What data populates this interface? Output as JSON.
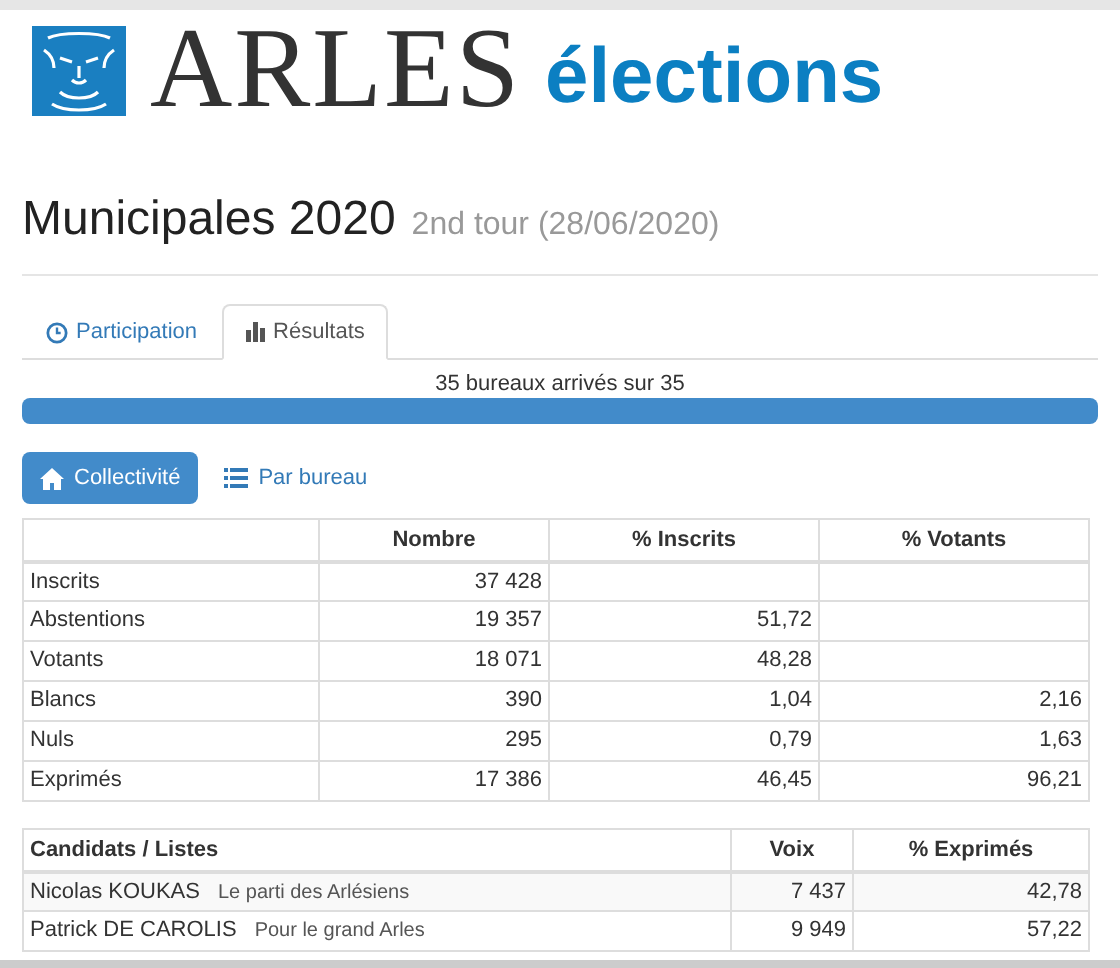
{
  "header": {
    "logo_word": "ARLES",
    "subtitle": "élections"
  },
  "title": {
    "main": "Municipales 2020",
    "sub": "2nd tour (28/06/2020)"
  },
  "tabs": [
    {
      "label": "Participation",
      "kind": "clock",
      "selected": false
    },
    {
      "label": "Résultats",
      "kind": "chart",
      "selected": true
    }
  ],
  "progress": {
    "label": "35 bureaux arrivés sur 35",
    "level": 1
  },
  "view_buttons": [
    {
      "label": "Collectivité",
      "kind": "home",
      "selected": true
    },
    {
      "label": "Par bureau",
      "kind": "list",
      "selected": false
    }
  ],
  "summary_table": {
    "columns": [
      "",
      "Nombre",
      "% Inscrits",
      "% Votants"
    ],
    "rows": [
      [
        "Inscrits",
        "37 428",
        "",
        ""
      ],
      [
        "Abstentions",
        "19 357",
        "51,72",
        ""
      ],
      [
        "Votants",
        "18 071",
        "48,28",
        ""
      ],
      [
        "Blancs",
        "390",
        "1,04",
        "2,16"
      ],
      [
        "Nuls",
        "295",
        "0,79",
        "1,63"
      ],
      [
        "Exprimés",
        "17 386",
        "46,45",
        "96,21"
      ]
    ]
  },
  "results_table": {
    "columns": [
      "Candidats / Listes",
      "Voix",
      "% Exprimés"
    ],
    "rows": [
      {
        "candidate": "Nicolas KOUKAS",
        "list": "Le parti des Arlésiens",
        "votes": "7 437",
        "percent": "42,78"
      },
      {
        "candidate": "Patrick DE CAROLIS",
        "list": "Pour le grand Arles",
        "votes": "9 949",
        "percent": "57,22"
      }
    ]
  }
}
